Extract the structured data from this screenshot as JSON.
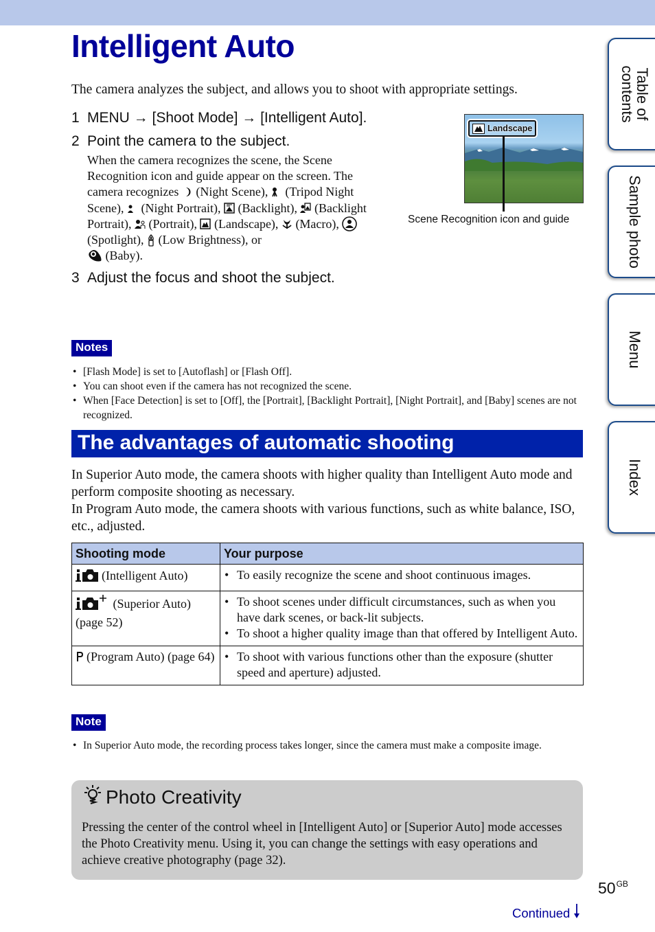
{
  "page": {
    "title": "Intelligent Auto",
    "intro": "The camera analyzes the subject, and allows you to shoot with appropriate settings.",
    "page_number": "50",
    "page_suffix": "GB",
    "continued_label": "Continued"
  },
  "steps": [
    {
      "num": "1",
      "text": "MENU → [Shoot Mode] → [Intelligent Auto]."
    },
    {
      "num": "2",
      "text": "Point the camera to the subject.",
      "body_intro": "When the camera recognizes the scene, the Scene Recognition icon and guide appear on the screen. The camera recognizes",
      "scenes": [
        {
          "icon": "night-scene-icon",
          "label": "(Night Scene),"
        },
        {
          "icon": "tripod-night-scene-icon",
          "label": "(Tripod Night Scene),"
        },
        {
          "icon": "night-portrait-icon",
          "label": "(Night Portrait),"
        },
        {
          "icon": "backlight-icon",
          "label": "(Backlight),"
        },
        {
          "icon": "backlight-portrait-icon",
          "label": "(Backlight Portrait),"
        },
        {
          "icon": "portrait-icon",
          "label": "(Portrait),"
        },
        {
          "icon": "landscape-icon",
          "label": "(Landscape),"
        },
        {
          "icon": "macro-icon",
          "label": "(Macro),"
        },
        {
          "icon": "spotlight-icon",
          "label": "(Spotlight),"
        },
        {
          "icon": "low-brightness-icon",
          "label": "(Low Brightness), or"
        },
        {
          "icon": "baby-icon",
          "label": "(Baby)."
        }
      ]
    },
    {
      "num": "3",
      "text": "Adjust the focus and shoot the subject."
    }
  ],
  "figure": {
    "guide_label": "Landscape",
    "caption": "Scene Recognition icon and guide"
  },
  "notes": {
    "label": "Notes",
    "items": [
      "[Flash Mode] is set to [Autoflash] or [Flash Off].",
      "You can shoot even if the camera has not recognized the scene.",
      "When [Face Detection] is set to [Off], the [Portrait], [Backlight Portrait], [Night Portrait], and [Baby] scenes are not recognized."
    ]
  },
  "section": {
    "heading": "The advantages of automatic shooting",
    "paragraphs": [
      "In Superior Auto mode, the camera shoots with higher quality than Intelligent Auto mode and perform composite shooting as necessary.",
      "In Program Auto mode, the camera shoots with various functions, such as white balance, ISO, etc., adjusted."
    ]
  },
  "table": {
    "headers": [
      "Shooting mode",
      "Your purpose"
    ],
    "rows": [
      {
        "icon": "intelligent-auto-icon",
        "mode": "(Intelligent Auto)",
        "purposes": [
          "To easily recognize the scene and shoot continuous images."
        ]
      },
      {
        "icon": "superior-auto-icon",
        "mode": " (Superior Auto) (page 52)",
        "purposes": [
          "To shoot scenes under difficult circumstances, such as when you have dark scenes, or back-lit subjects.",
          "To shoot a higher quality image than that offered by Intelligent Auto."
        ]
      },
      {
        "icon": "program-auto-icon",
        "mode": "(Program Auto) (page 64)",
        "purposes": [
          "To shoot with various functions other than the exposure (shutter speed and aperture) adjusted."
        ]
      }
    ]
  },
  "note": {
    "label": "Note",
    "items": [
      "In Superior Auto mode, the recording process takes longer, since the camera must make a composite image."
    ]
  },
  "photo_creativity": {
    "title": "Photo Creativity",
    "text": "Pressing the center of the control wheel in [Intelligent Auto] or [Superior Auto] mode accesses the Photo Creativity menu. Using it, you can change the settings with easy operations and achieve creative photography (page 32)."
  },
  "side_tabs": [
    {
      "label": "Table of\ncontents"
    },
    {
      "label": "Sample photo"
    },
    {
      "label": "Menu"
    },
    {
      "label": "Index"
    }
  ],
  "colors": {
    "title_blue": "#000099",
    "section_blue": "#0022aa",
    "header_band": "#b8c8ea",
    "tip_box_gray": "#cccccc",
    "tab_border": "#1c4b8a"
  }
}
